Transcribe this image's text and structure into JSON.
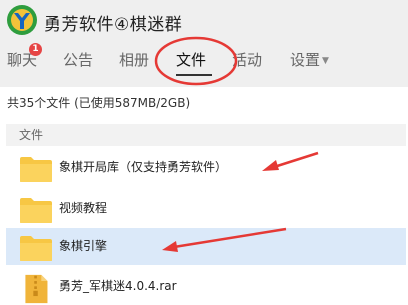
{
  "window": {
    "title": "勇芳软件④棋迷群"
  },
  "tabs": [
    {
      "label": "聊天",
      "badge": "1"
    },
    {
      "label": "公告"
    },
    {
      "label": "相册"
    },
    {
      "label": "文件",
      "active": true
    },
    {
      "label": "活动"
    },
    {
      "label": "设置",
      "has_dropdown": true
    }
  ],
  "storage_info": "共35个文件 (已使用587MB/2GB)",
  "file_list": {
    "section_header": "文件",
    "items": [
      {
        "name": "象棋开局库（仅支持勇芳软件）",
        "type": "folder"
      },
      {
        "name": "视频教程",
        "type": "folder"
      },
      {
        "name": "象棋引擎",
        "type": "folder",
        "selected": true
      },
      {
        "name": "勇芳_军棋迷4.0.4.rar",
        "type": "archive"
      }
    ]
  },
  "colors": {
    "folder": "#f7c744",
    "selected_row": "#dbe9f9",
    "annotation": "#e53935",
    "badge": "#e64545"
  },
  "icons": {
    "app_logo": "yf-logo-icon",
    "folder": "folder-icon",
    "archive": "archive-file-icon",
    "dropdown": "caret-down-icon"
  }
}
